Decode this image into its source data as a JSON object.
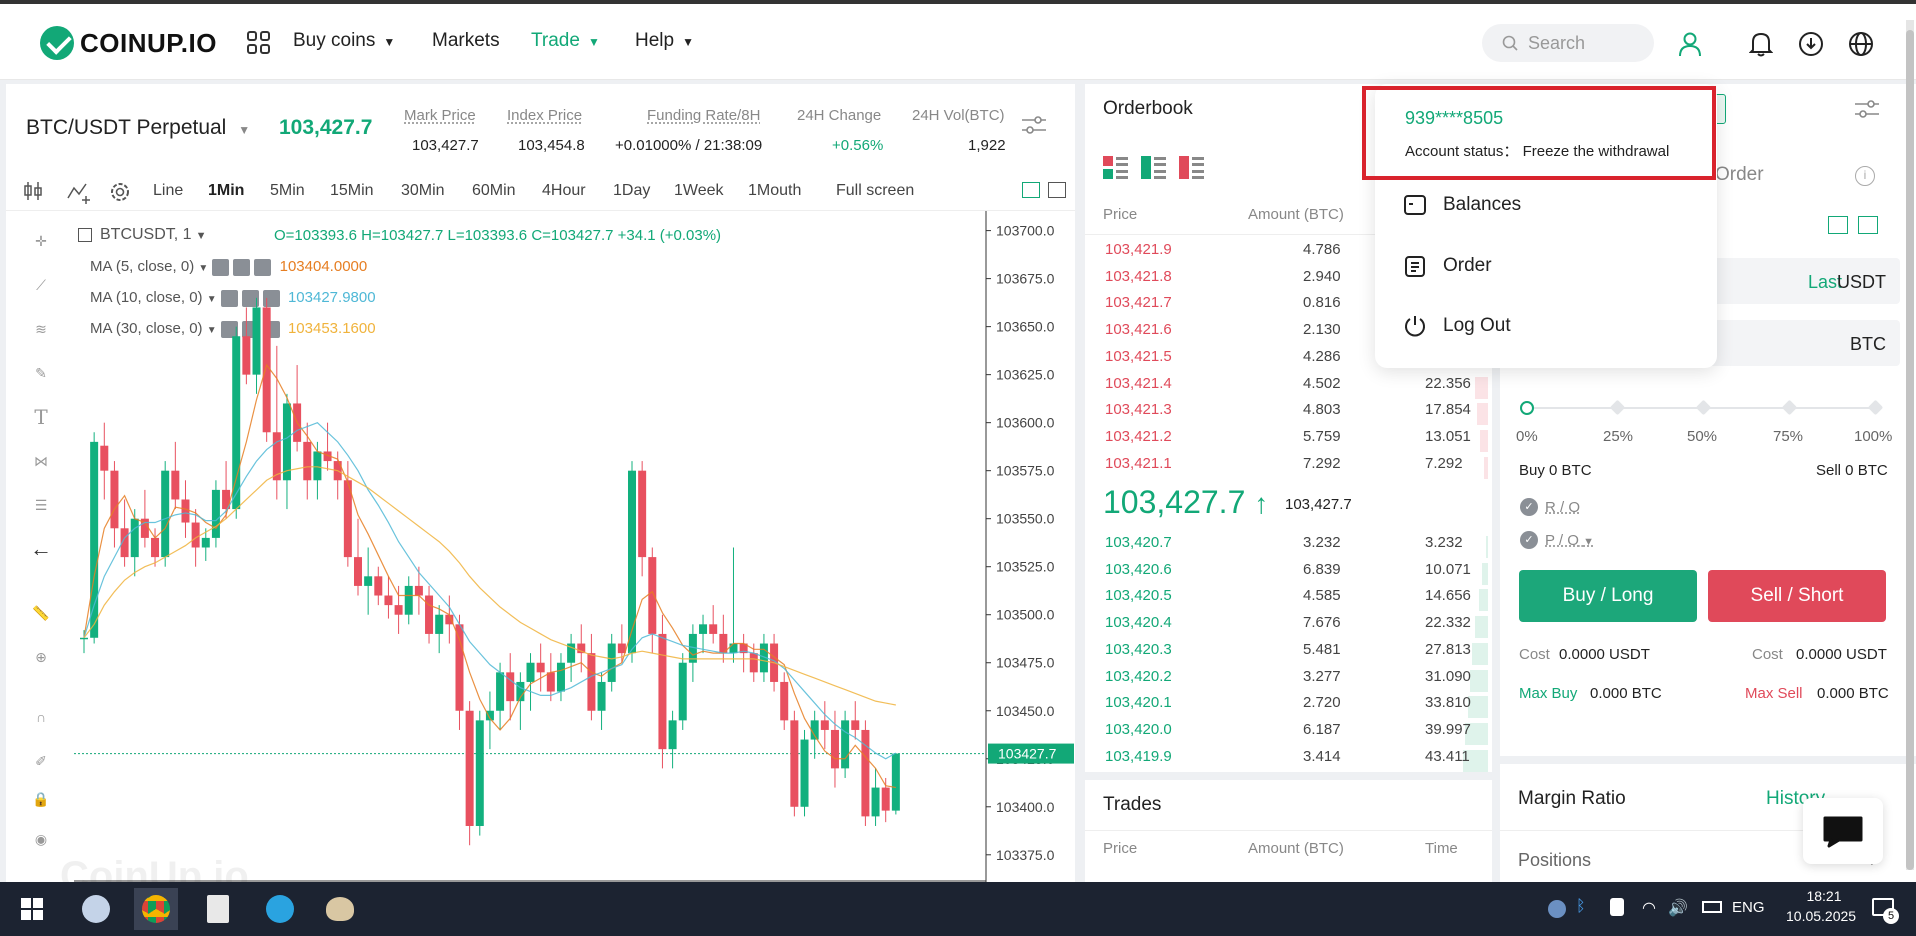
{
  "header": {
    "logo_text": "COINUP.IO",
    "nav": [
      {
        "label": "Buy coins",
        "has_caret": true
      },
      {
        "label": "Markets",
        "has_caret": false
      },
      {
        "label": "Trade",
        "has_caret": true
      },
      {
        "label": "Help",
        "has_caret": true
      }
    ],
    "search_placeholder": "Search"
  },
  "ticker": {
    "pair": "BTC/USDT Perpetual",
    "last_price": "103,427.7",
    "stats": [
      {
        "label": "Mark Price",
        "value": "103,427.7"
      },
      {
        "label": "Index Price",
        "value": "103,454.8"
      },
      {
        "label": "Funding Rate/8H",
        "value": "+0.01000% / 21:38:09"
      },
      {
        "label": "24H Change",
        "value": "+0.56%"
      },
      {
        "label": "24H Vol(BTC)",
        "value": "1,922"
      }
    ]
  },
  "timeframes": [
    "Line",
    "1Min",
    "5Min",
    "15Min",
    "30Min",
    "60Min",
    "4Hour",
    "1Day",
    "1Week",
    "1Mouth",
    "Full screen"
  ],
  "active_timeframe": "1Min",
  "chart_header": {
    "symbol": "BTCUSDT, 1",
    "ohlc": "O=103393.6  H=103427.7  L=103393.6  C=103427.7  +34.1 (+0.03%)"
  },
  "indicators": [
    {
      "label": "MA (5, close, 0)",
      "value": "103404.0000",
      "color": "#e67e22"
    },
    {
      "label": "MA (10, close, 0)",
      "value": "103427.9800",
      "color": "#4fb8d6"
    },
    {
      "label": "MA (30, close, 0)",
      "value": "103453.1600",
      "color": "#f0b33c"
    }
  ],
  "chart_data": {
    "type": "candlestick",
    "yaxis_ticks": [
      "103700.0",
      "103675.0",
      "103650.0",
      "103625.0",
      "103600.0",
      "103575.0",
      "103550.0",
      "103525.0",
      "103500.0",
      "103475.0",
      "103450.0",
      "103425.0",
      "103400.0",
      "103375.0"
    ],
    "ylim": [
      103365,
      103705
    ],
    "current_price_label": "103427.7",
    "current_price": 103427.7,
    "candles": [
      [
        103488,
        103492,
        103480,
        103488
      ],
      [
        103488,
        103595,
        103485,
        103590
      ],
      [
        103588,
        103600,
        103560,
        103575
      ],
      [
        103575,
        103580,
        103535,
        103545
      ],
      [
        103545,
        103560,
        103525,
        103530
      ],
      [
        103530,
        103555,
        103520,
        103550
      ],
      [
        103550,
        103565,
        103535,
        103540
      ],
      [
        103540,
        103545,
        103525,
        103530
      ],
      [
        103530,
        103580,
        103525,
        103575
      ],
      [
        103575,
        103590,
        103555,
        103560
      ],
      [
        103560,
        103570,
        103540,
        103548
      ],
      [
        103548,
        103555,
        103525,
        103535
      ],
      [
        103535,
        103545,
        103528,
        103540
      ],
      [
        103540,
        103570,
        103535,
        103565
      ],
      [
        103565,
        103580,
        103550,
        103555
      ],
      [
        103555,
        103650,
        103550,
        103645
      ],
      [
        103645,
        103660,
        103620,
        103625
      ],
      [
        103625,
        103665,
        103615,
        103660
      ],
      [
        103660,
        103665,
        103590,
        103595
      ],
      [
        103595,
        103640,
        103560,
        103570
      ],
      [
        103570,
        103615,
        103555,
        103610
      ],
      [
        103610,
        103630,
        103585,
        103590
      ],
      [
        103590,
        103600,
        103560,
        103570
      ],
      [
        103570,
        103590,
        103560,
        103585
      ],
      [
        103585,
        103600,
        103575,
        103580
      ],
      [
        103580,
        103585,
        103560,
        103570
      ],
      [
        103570,
        103580,
        103525,
        103530
      ],
      [
        103530,
        103550,
        103510,
        103515
      ],
      [
        103515,
        103535,
        103500,
        103520
      ],
      [
        103520,
        103525,
        103505,
        103510
      ],
      [
        103510,
        103520,
        103498,
        103505
      ],
      [
        103505,
        103515,
        103490,
        103500
      ],
      [
        103500,
        103520,
        103495,
        103515
      ],
      [
        103515,
        103525,
        103500,
        103510
      ],
      [
        103510,
        103515,
        103485,
        103490
      ],
      [
        103490,
        103505,
        103480,
        103500
      ],
      [
        103500,
        103510,
        103485,
        103495
      ],
      [
        103495,
        103500,
        103440,
        103450
      ],
      [
        103450,
        103455,
        103380,
        103390
      ],
      [
        103390,
        103450,
        103385,
        103445
      ],
      [
        103445,
        103460,
        103430,
        103450
      ],
      [
        103450,
        103475,
        103440,
        103470
      ],
      [
        103470,
        103480,
        103445,
        103455
      ],
      [
        103455,
        103470,
        103440,
        103465
      ],
      [
        103465,
        103480,
        103450,
        103475
      ],
      [
        103475,
        103485,
        103460,
        103470
      ],
      [
        103470,
        103480,
        103455,
        103460
      ],
      [
        103460,
        103480,
        103455,
        103475
      ],
      [
        103475,
        103490,
        103465,
        103485
      ],
      [
        103485,
        103495,
        103470,
        103480
      ],
      [
        103480,
        103490,
        103445,
        103450
      ],
      [
        103450,
        103470,
        103440,
        103465
      ],
      [
        103465,
        103490,
        103460,
        103485
      ],
      [
        103485,
        103495,
        103475,
        103480
      ],
      [
        103480,
        103580,
        103475,
        103575
      ],
      [
        103575,
        103580,
        103520,
        103530
      ],
      [
        103530,
        103535,
        103480,
        103490
      ],
      [
        103490,
        103500,
        103420,
        103430
      ],
      [
        103430,
        103450,
        103420,
        103445
      ],
      [
        103445,
        103480,
        103440,
        103475
      ],
      [
        103475,
        103495,
        103465,
        103490
      ],
      [
        103490,
        103500,
        103480,
        103495
      ],
      [
        103495,
        103505,
        103485,
        103490
      ],
      [
        103490,
        103500,
        103475,
        103480
      ],
      [
        103480,
        103535,
        103475,
        103485
      ],
      [
        103485,
        103490,
        103470,
        103480
      ],
      [
        103480,
        103485,
        103465,
        103470
      ],
      [
        103470,
        103490,
        103465,
        103485
      ],
      [
        103485,
        103490,
        103460,
        103465
      ],
      [
        103465,
        103470,
        103440,
        103445
      ],
      [
        103445,
        103450,
        103395,
        103400
      ],
      [
        103400,
        103440,
        103395,
        103435
      ],
      [
        103435,
        103450,
        103425,
        103445
      ],
      [
        103445,
        103455,
        103430,
        103440
      ],
      [
        103440,
        103450,
        103410,
        103420
      ],
      [
        103420,
        103450,
        103415,
        103445
      ],
      [
        103445,
        103455,
        103435,
        103440
      ],
      [
        103440,
        103445,
        103390,
        103395
      ],
      [
        103395,
        103420,
        103390,
        103410
      ],
      [
        103410,
        103415,
        103392,
        103398
      ],
      [
        103398,
        103428,
        103396,
        103427.7
      ]
    ],
    "ma_series": [
      {
        "name": "MA5",
        "color": "#e67e22",
        "values": [
          103488,
          103520,
          103545,
          103555,
          103562,
          103550,
          103548,
          103540,
          103545,
          103556,
          103555,
          103553,
          103548,
          103545,
          103552,
          103571,
          103590,
          103612,
          103630,
          103623,
          103613,
          103600,
          103593,
          103585,
          103583,
          103581,
          103569,
          103552,
          103542,
          103531,
          103520,
          103510,
          103510,
          103510,
          103505,
          103503,
          103500,
          103487,
          103470,
          103456,
          103446,
          103440,
          103446,
          103457,
          103464,
          103467,
          103470,
          103471,
          103473,
          103475,
          103470,
          103468,
          103472,
          103475,
          103492,
          103508,
          103512,
          103501,
          103493,
          103484,
          103479,
          103481,
          103480,
          103480,
          103485,
          103485,
          103482,
          103482,
          103478,
          103474,
          103459,
          103446,
          103437,
          103429,
          103425,
          103425,
          103432,
          103426,
          103420,
          103411,
          103410
        ]
      },
      {
        "name": "MA10",
        "color": "#4fb8d6",
        "values": [
          103488,
          103505,
          103520,
          103530,
          103540,
          103545,
          103548,
          103548,
          103550,
          103552,
          103553,
          103552,
          103549,
          103549,
          103554,
          103563,
          103572,
          103580,
          103586,
          103590,
          103592,
          103596,
          103598,
          103600,
          103595,
          103590,
          103583,
          103575,
          103565,
          103557,
          103548,
          103538,
          103530,
          103522,
          103516,
          103510,
          103504,
          103495,
          103486,
          103480,
          103474,
          103470,
          103466,
          103462,
          103460,
          103458,
          103458,
          103460,
          103462,
          103465,
          103468,
          103470,
          103472,
          103474,
          103482,
          103488,
          103490,
          103488,
          103486,
          103484,
          103483,
          103482,
          103481,
          103480,
          103480,
          103481,
          103480,
          103478,
          103476,
          103472,
          103466,
          103460,
          103454,
          103448,
          103443,
          103439,
          103436,
          103432,
          103428,
          103425,
          103428
        ]
      },
      {
        "name": "MA30",
        "color": "#f0b33c",
        "values": [
          103488,
          103495,
          103505,
          103512,
          103518,
          103522,
          103525,
          103527,
          103530,
          103533,
          103536,
          103540,
          103543,
          103546,
          103550,
          103555,
          103560,
          103565,
          103570,
          103573,
          103575,
          103576,
          103577,
          103577,
          103576,
          103575,
          103572,
          103569,
          103566,
          103562,
          103558,
          103554,
          103550,
          103546,
          103542,
          103538,
          103533,
          103527,
          103520,
          103514,
          103509,
          103504,
          103500,
          103496,
          103493,
          103490,
          103487,
          103485,
          103483,
          103481,
          103479,
          103478,
          103477,
          103478,
          103480,
          103481,
          103480,
          103479,
          103478,
          103477,
          103477,
          103477,
          103477,
          103477,
          103477,
          103477,
          103477,
          103476,
          103475,
          103473,
          103471,
          103469,
          103467,
          103465,
          103463,
          103461,
          103459,
          103457,
          103455,
          103454,
          103453
        ]
      }
    ]
  },
  "orderbook": {
    "title": "Orderbook",
    "headers": [
      "Price",
      "Amount (BTC)",
      "Total"
    ],
    "asks": [
      {
        "price": "103,421.9",
        "amount": "4.786",
        "total": "",
        "depth": 0
      },
      {
        "price": "103,421.8",
        "amount": "2.940",
        "total": "",
        "depth": 0
      },
      {
        "price": "103,421.7",
        "amount": "0.816",
        "total": "",
        "depth": 0
      },
      {
        "price": "103,421.6",
        "amount": "2.130",
        "total": "",
        "depth": 0
      },
      {
        "price": "103,421.5",
        "amount": "4.286",
        "total": "",
        "depth": 0
      },
      {
        "price": "103,421.4",
        "amount": "4.502",
        "total": "22.356",
        "depth": 0.52
      },
      {
        "price": "103,421.3",
        "amount": "4.803",
        "total": "17.854",
        "depth": 0.42
      },
      {
        "price": "103,421.2",
        "amount": "5.759",
        "total": "13.051",
        "depth": 0.3
      },
      {
        "price": "103,421.1",
        "amount": "7.292",
        "total": "7.292",
        "depth": 0.17
      }
    ],
    "mid_price": "103,427.7",
    "mid_mark": "103,427.7",
    "bids": [
      {
        "price": "103,420.7",
        "amount": "3.232",
        "total": "3.232",
        "depth": 0.08
      },
      {
        "price": "103,420.6",
        "amount": "6.839",
        "total": "10.071",
        "depth": 0.23
      },
      {
        "price": "103,420.5",
        "amount": "4.585",
        "total": "14.656",
        "depth": 0.34
      },
      {
        "price": "103,420.4",
        "amount": "7.676",
        "total": "22.332",
        "depth": 0.51
      },
      {
        "price": "103,420.3",
        "amount": "5.481",
        "total": "27.813",
        "depth": 0.64
      },
      {
        "price": "103,420.2",
        "amount": "3.277",
        "total": "31.090",
        "depth": 0.72
      },
      {
        "price": "103,420.1",
        "amount": "2.720",
        "total": "33.810",
        "depth": 0.78
      },
      {
        "price": "103,420.0",
        "amount": "6.187",
        "total": "39.997",
        "depth": 0.92
      },
      {
        "price": "103,419.9",
        "amount": "3.414",
        "total": "43.411",
        "depth": 1
      }
    ]
  },
  "trades": {
    "title": "Trades",
    "headers": [
      "Price",
      "Amount (BTC)",
      "Time"
    ]
  },
  "account_menu": {
    "account_id": "939****8505",
    "status_label": "Account status：",
    "status_value": "Freeze the withdrawal",
    "items": [
      "Balances",
      "Order",
      "Log Out"
    ]
  },
  "trade_form": {
    "tab_visible": "Order",
    "price_suffix_last": "Last",
    "price_unit": "USDT",
    "amount_unit": "BTC",
    "slider_marks": [
      "0%",
      "25%",
      "50%",
      "75%",
      "100%"
    ],
    "buy_avail": "Buy 0 BTC",
    "sell_avail": "Sell 0 BTC",
    "ro_label": "R / O",
    "po_label": "P / O",
    "buy_button": "Buy / Long",
    "sell_button": "Sell / Short",
    "cost_buy_label": "Cost",
    "cost_buy_value": "0.0000 USDT",
    "cost_sell_label": "Cost",
    "cost_sell_value": "0.0000 USDT",
    "max_buy_label": "Max Buy",
    "max_buy_value": "0.000 BTC",
    "max_sell_label": "Max Sell",
    "max_sell_value": "0.000 BTC"
  },
  "margin": {
    "title": "Margin Ratio",
    "history_link": "History data",
    "positions": "Positions"
  },
  "watermark": "CoinUp.io",
  "taskbar": {
    "lang": "ENG",
    "time": "18:21",
    "date": "10.05.2025",
    "notif_count": "5"
  },
  "colors": {
    "accent_green": "#12a877",
    "sell_red": "#e04a5a",
    "highlight_box": "#d9232d"
  }
}
